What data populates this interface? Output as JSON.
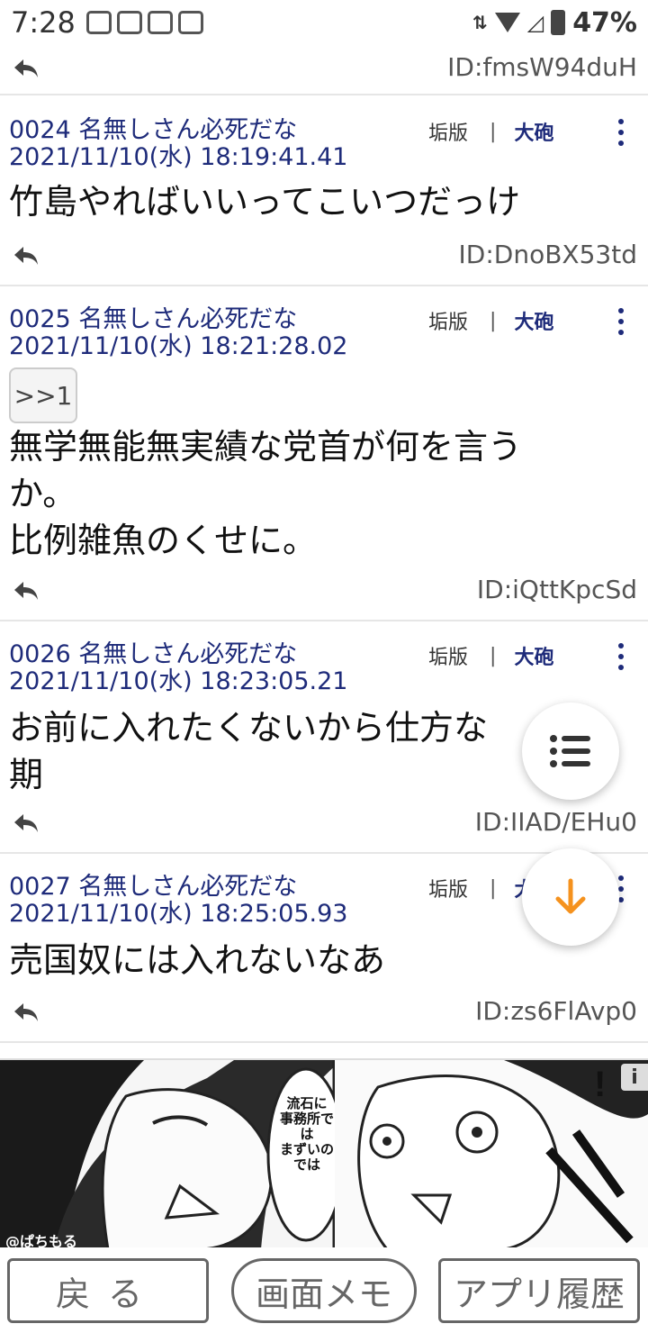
{
  "status_bar": {
    "time": "7:28",
    "battery": "47%"
  },
  "top": {
    "id": "ID:fmsW94duH"
  },
  "posts": [
    {
      "num": "0024",
      "name": "名無しさん必死だな",
      "date": "2021/11/10(水) 18:19:41.41",
      "header": "0024 名無しさん必死だな 2021/11/10(水) 18:19:41.41",
      "kaku": "垢版",
      "sep": "|",
      "taiho": "大砲",
      "body": "竹島やればいいってこいつだっけ",
      "id": "ID:DnoBX53td"
    },
    {
      "num": "0025",
      "name": "名無しさん必死だな",
      "date": "2021/11/10(水) 18:21:28.02",
      "header": "0025 名無しさん必死だな 2021/11/10(水) 18:21:28.02",
      "kaku": "垢版",
      "sep": "|",
      "taiho": "大砲",
      "anchor": ">>1",
      "body": "無学無能無実績な党首が何を言うか。\n比例雑魚のくせに。",
      "id": "ID:iQttKpcSd"
    },
    {
      "num": "0026",
      "name": "名無しさん必死だな",
      "date": "2021/11/10(水) 18:23:05.21",
      "header": "0026 名無しさん必死だな 2021/11/10(水) 18:23:05.21",
      "kaku": "垢版",
      "sep": "|",
      "taiho": "大砲",
      "body": "お前に入れたくないから仕方な　\n期",
      "id": "ID:IIAD/EHu0"
    },
    {
      "num": "0027",
      "name": "名無しさん必死だな",
      "date": "2021/11/10(水) 18:25:05.93",
      "header": "0027 名無しさん必死だな 2021/11/10(水) 18:25:05.93",
      "kaku": "垢版",
      "sep": "|",
      "taiho": "大",
      "body": "売国奴には入れないなあ",
      "id": "ID:zs6FlAvp0"
    }
  ],
  "ad": {
    "speech": "流石に\n事務所では\nまずいのでは",
    "info": "i",
    "credit": "@ぱちもる"
  },
  "bottom_bar": {
    "back": "戻る",
    "memo": "画面メモ",
    "history": "アプリ履歴"
  },
  "colors": {
    "accent": "#1e2b7a",
    "fab_arrow": "#f5921e"
  },
  "icons": [
    "reply-icon",
    "more-vert-icon",
    "list-icon",
    "arrow-down-icon"
  ]
}
